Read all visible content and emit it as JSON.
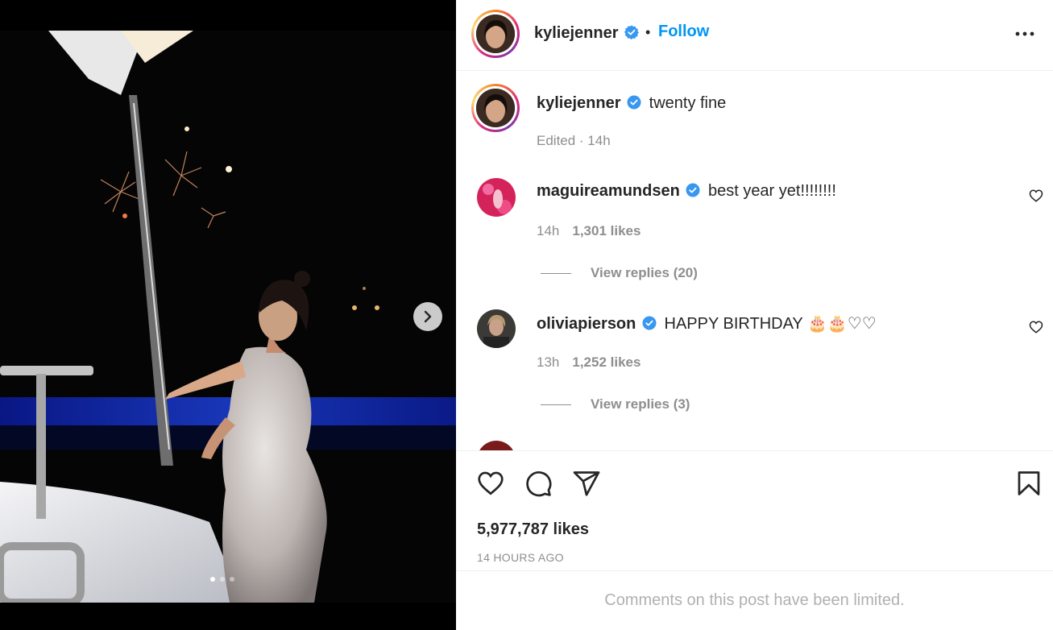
{
  "header": {
    "username": "kyliejenner",
    "follow_label": "Follow",
    "separator": "•"
  },
  "caption": {
    "username": "kyliejenner",
    "text": "twenty fine",
    "meta": "Edited · 14h"
  },
  "comments": [
    {
      "username": "maguireamundsen",
      "text": "best year yet!!!!!!!!",
      "time": "14h",
      "likes": "1,301 likes",
      "replies": "View replies (20)"
    },
    {
      "username": "oliviapierson",
      "text": "HAPPY BIRTHDAY 🎂🎂♡♡",
      "time": "13h",
      "likes": "1,252 likes",
      "replies": "View replies (3)"
    }
  ],
  "post": {
    "likes": "5,977,787 likes",
    "timestamp": "14 HOURS AGO",
    "comments_limited": "Comments on this post have been limited."
  },
  "carousel": {
    "count": 3,
    "active": 1
  },
  "colors": {
    "follow": "#0095f6",
    "verified": "#3897f0",
    "muted": "#8e8e8e",
    "text": "#262626"
  },
  "icons": [
    "verified-badge-icon",
    "more-options-icon",
    "heart-icon",
    "comment-icon",
    "share-icon",
    "bookmark-icon",
    "chevron-right-icon"
  ]
}
